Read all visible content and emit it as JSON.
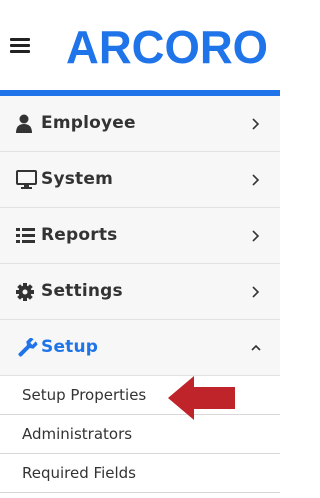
{
  "header": {
    "logo_text": "ARCORO"
  },
  "menu": {
    "items": [
      {
        "label": "Employee",
        "icon": "user-icon"
      },
      {
        "label": "System",
        "icon": "monitor-icon"
      },
      {
        "label": "Reports",
        "icon": "list-icon"
      },
      {
        "label": "Settings",
        "icon": "gear-icon"
      },
      {
        "label": "Setup",
        "icon": "wrench-icon",
        "expanded": true
      }
    ],
    "sub_items": [
      {
        "label": "Setup Properties"
      },
      {
        "label": "Administrators"
      },
      {
        "label": "Required Fields"
      }
    ]
  },
  "colors": {
    "accent": "#1e74e8",
    "arrow": "#c0242b"
  }
}
